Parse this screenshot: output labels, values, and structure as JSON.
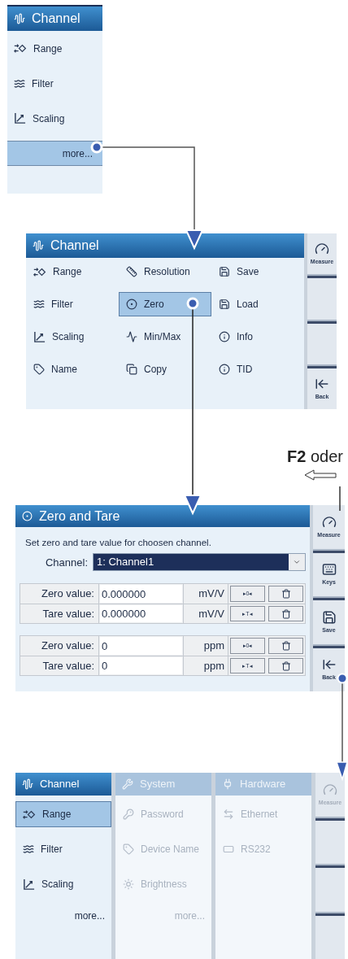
{
  "overview_menu": {
    "title": "Channel",
    "items": [
      {
        "label": "Range",
        "selected": false
      },
      {
        "label": "Filter",
        "selected": false
      },
      {
        "label": "Scaling",
        "selected": false
      }
    ],
    "more": {
      "label": "more...",
      "selected": true
    }
  },
  "channel_menu": {
    "title": "Channel",
    "columns": [
      [
        {
          "label": "Range",
          "selected": false
        },
        {
          "label": "Filter",
          "selected": false
        },
        {
          "label": "Scaling",
          "selected": false
        },
        {
          "label": "Name",
          "selected": false
        }
      ],
      [
        {
          "label": "Resolution",
          "selected": false
        },
        {
          "label": "Zero",
          "selected": true
        },
        {
          "label": "Min/Max",
          "selected": false
        },
        {
          "label": "Copy",
          "selected": false
        }
      ],
      [
        {
          "label": "Save",
          "selected": false
        },
        {
          "label": "Load",
          "selected": false
        },
        {
          "label": "Info",
          "selected": false
        },
        {
          "label": "TID",
          "selected": false
        }
      ]
    ],
    "sidebar": [
      {
        "label": "Measure",
        "disabled": false
      },
      {
        "label": "Back",
        "disabled": false
      }
    ]
  },
  "callout": "**F2** oder",
  "zero_tare": {
    "title": "Zero and Tare",
    "description": "Set zero and tare value for choosen channel.",
    "channel": {
      "label": "Channel:",
      "value": "1: Channel1"
    },
    "tables": [
      [
        {
          "label": "Zero value:",
          "value": "0.000000",
          "unit": "mV/V",
          "action": "▸0◂"
        },
        {
          "label": "Tare value:",
          "value": "0.000000",
          "unit": "mV/V",
          "action": "▸T◂"
        }
      ],
      [
        {
          "label": "Zero value:",
          "value": "0",
          "unit": "ppm",
          "action": "▸0◂"
        },
        {
          "label": "Tare value:",
          "value": "0",
          "unit": "ppm",
          "action": "▸T◂"
        }
      ]
    ],
    "sidebar": [
      {
        "label": "Measure",
        "disabled": false
      },
      {
        "label": "Keys",
        "disabled": false
      },
      {
        "label": "Save",
        "disabled": false
      },
      {
        "label": "Back",
        "disabled": false
      }
    ]
  },
  "main_menu": {
    "tabs": [
      {
        "title": "Channel",
        "disabled": false,
        "items": [
          {
            "label": "Range",
            "selected": true
          },
          {
            "label": "Filter",
            "selected": false
          },
          {
            "label": "Scaling",
            "selected": false
          }
        ],
        "more": "more..."
      },
      {
        "title": "System",
        "disabled": true,
        "items": [
          {
            "label": "Password",
            "selected": false
          },
          {
            "label": "Device Name",
            "selected": false
          },
          {
            "label": "Brightness",
            "selected": false
          }
        ],
        "more": "more..."
      },
      {
        "title": "Hardware",
        "disabled": true,
        "items": [
          {
            "label": "Ethernet",
            "selected": false
          },
          {
            "label": "RS232",
            "selected": false
          }
        ]
      }
    ],
    "sidebar": [
      {
        "label": "Measure",
        "disabled": true
      }
    ]
  }
}
